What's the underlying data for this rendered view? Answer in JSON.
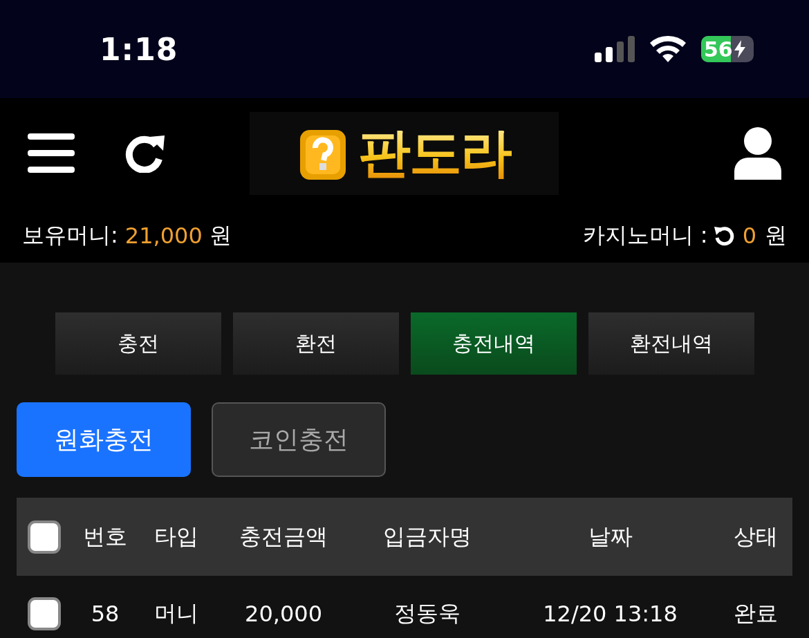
{
  "status_bar": {
    "time": "1:18",
    "battery": "56"
  },
  "header": {
    "logo_text": "판도라"
  },
  "balances": {
    "money_label": "보유머니:",
    "money_value": "21,000",
    "money_unit": "원",
    "casino_label": "카지노머니 :",
    "casino_value": "0",
    "casino_unit": "원"
  },
  "tabs": [
    {
      "label": "충전",
      "selected": false
    },
    {
      "label": "환전",
      "selected": false
    },
    {
      "label": "충전내역",
      "selected": true
    },
    {
      "label": "환전내역",
      "selected": false
    }
  ],
  "sub_tabs": [
    {
      "label": "원화충전",
      "selected": true
    },
    {
      "label": "코인충전",
      "selected": false
    }
  ],
  "table": {
    "select_all_checked": false,
    "columns": [
      "번호",
      "타입",
      "충전금액",
      "입금자명",
      "날짜",
      "상태"
    ],
    "rows": [
      {
        "checked": false,
        "cells": [
          "58",
          "머니",
          "20,000",
          "정동욱",
          "12/20 13:18",
          "완료"
        ]
      }
    ]
  }
}
